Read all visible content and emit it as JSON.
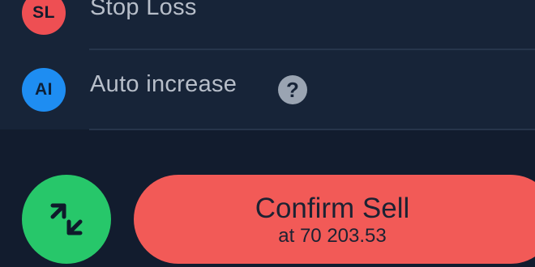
{
  "options": [
    {
      "badge": "SL",
      "label": "Stop Loss"
    },
    {
      "badge": "AI",
      "label": "Auto increase",
      "help": "?"
    }
  ],
  "actions": {
    "swap_icon": "arrows-swap-icon",
    "confirm_label": "Confirm Sell",
    "confirm_price": "at 70 203.53"
  },
  "colors": {
    "background": "#121c2e",
    "panel": "#172438",
    "stop_loss_badge": "#ee4f53",
    "auto_increase_badge": "#1e8df2",
    "swap_button": "#27c76a",
    "confirm_button": "#f25a57"
  }
}
